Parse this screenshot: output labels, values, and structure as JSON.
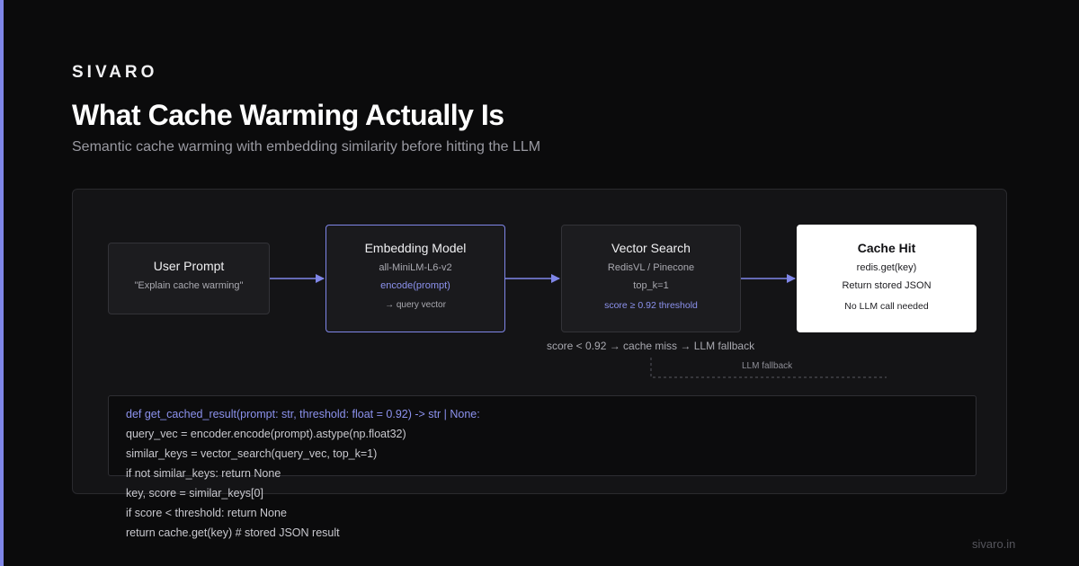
{
  "brand": "SIVARO",
  "title": "What Cache Warming Actually Is",
  "subtitle": "Semantic cache warming with embedding similarity before hitting the LLM",
  "colors": {
    "accent": "#7f86e8",
    "background": "#0b0b0c",
    "panel": "#141416",
    "hit_box": "#ffffff"
  },
  "nodes": {
    "prompt": {
      "title": "User Prompt",
      "line1": "\"Explain cache warming\""
    },
    "embed": {
      "title": "Embedding Model",
      "line1": "all-MiniLM-L6-v2",
      "line2": "encode(prompt)",
      "line3": "→ query vector"
    },
    "search": {
      "title": "Vector Search",
      "line1": "RedisVL / Pinecone",
      "line2": "top_k=1",
      "line3": "score ≥ 0.92 threshold"
    },
    "hit": {
      "title": "Cache Hit",
      "line1": "redis.get(key)",
      "line2": "Return stored JSON",
      "line3": "No LLM call needed"
    }
  },
  "miss_note": "score < 0.92 → cache miss → LLM fallback",
  "fallback_label": "LLM fallback",
  "code": [
    "def get_cached_result(prompt: str, threshold: float = 0.92) -> str | None:",
    "query_vec = encoder.encode(prompt).astype(np.float32)",
    "similar_keys = vector_search(query_vec, top_k=1)",
    "if not similar_keys: return None",
    "key, score = similar_keys[0]",
    "if score < threshold: return None",
    "return cache.get(key) # stored JSON result"
  ],
  "footer": "sivaro.in"
}
